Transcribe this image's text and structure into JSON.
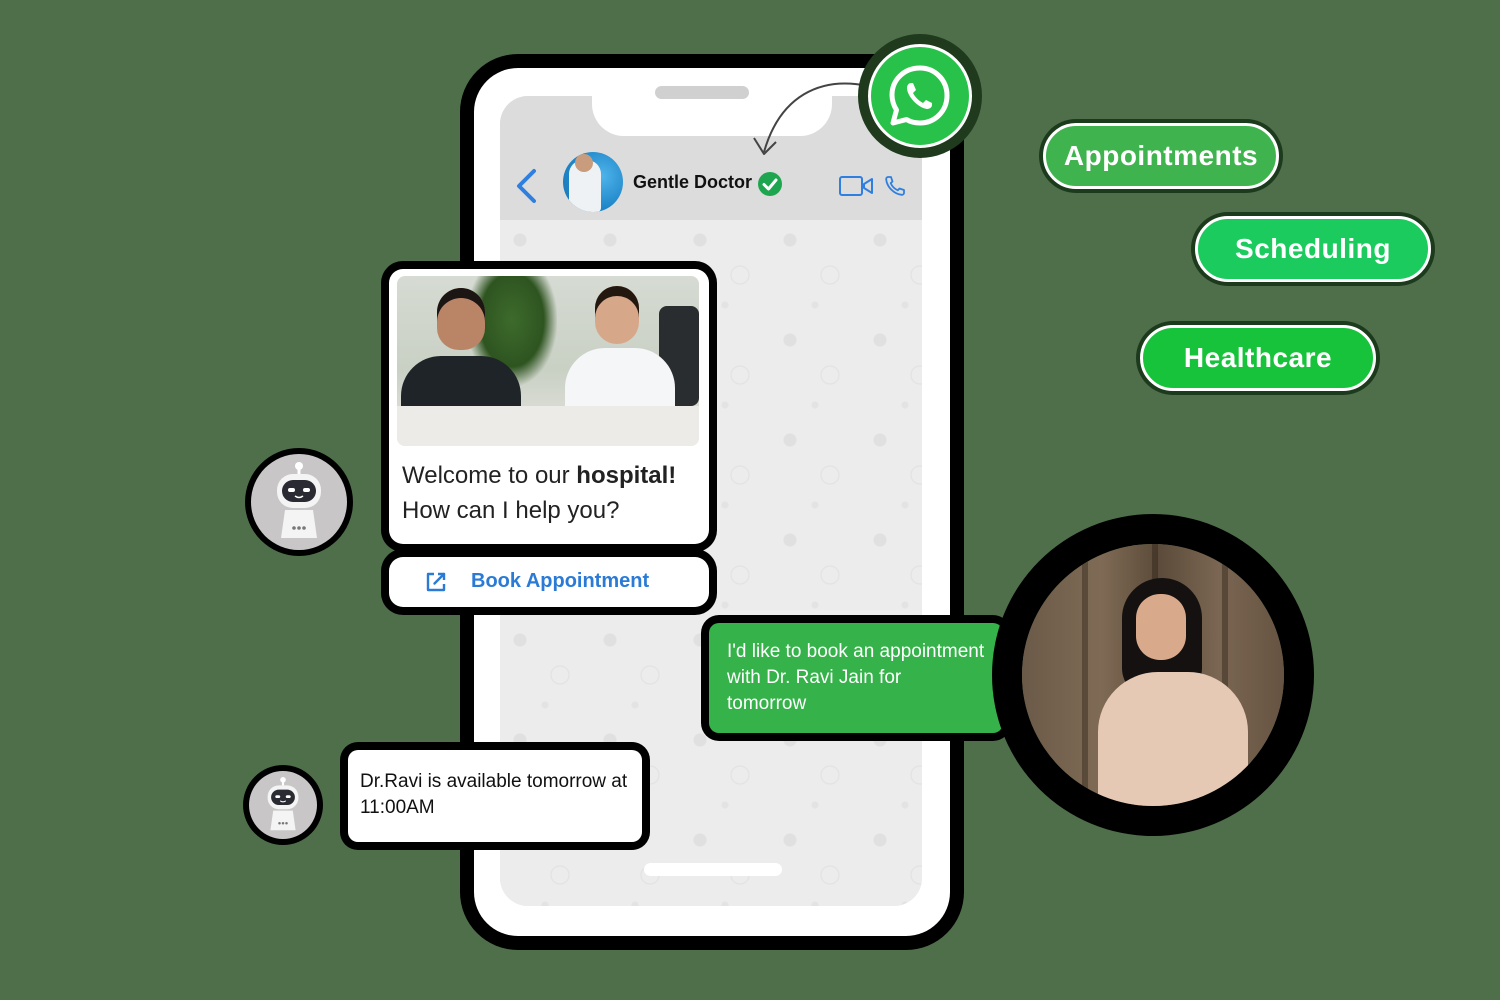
{
  "chat": {
    "contact_name": "Gentle Doctor",
    "icons": {
      "back": "back-chevron-icon",
      "verified": "verified-badge-icon",
      "video": "video-call-icon",
      "call": "phone-call-icon",
      "brand": "whatsapp-icon"
    }
  },
  "welcome": {
    "line1_prefix": "Welcome to our ",
    "line1_bold": "hospital!",
    "line2": "How can I help you?"
  },
  "book_button": {
    "label": "Book Appointment",
    "icon": "external-link-icon"
  },
  "user_message": "I'd like to book an appointment with Dr. Ravi Jain for tomorrow",
  "bot_reply": "Dr.Ravi is available tomorrow at 11:00AM",
  "tags": [
    "Appointments",
    "Scheduling",
    "Healthcare"
  ],
  "colors": {
    "background": "#4f6f4b",
    "whatsapp_green": "#28c24a",
    "user_bubble": "#36b24a",
    "link_blue": "#2b7bd6"
  }
}
